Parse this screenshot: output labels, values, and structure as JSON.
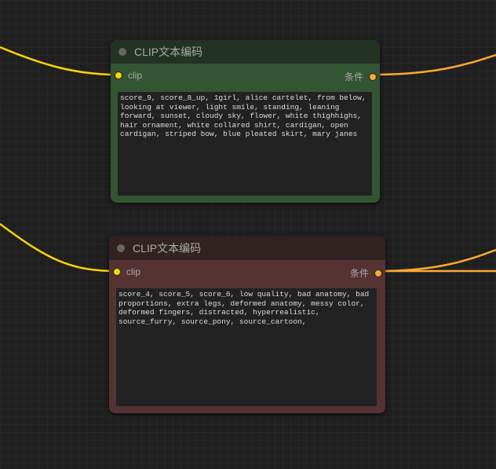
{
  "nodes": [
    {
      "title": "CLIP文本编码",
      "input": "clip",
      "output": "条件",
      "text": "score_9, score_8_up, 1girl, alice cartelet, from below, looking at viewer, light smile, standing, leaning forward, sunset, cloudy sky, flower, white thighhighs, hair ornament, white collared shirt, cardigan, open cardigan, striped bow, blue pleated skirt, mary janes"
    },
    {
      "title": "CLIP文本编码",
      "input": "clip",
      "output": "条件",
      "text": "score_4, score_5, score_6, low quality, bad anatomy, bad proportions, extra legs, deformed anatomy, messy color, deformed fingers, distracted, hyperrealistic, source_furry, source_pony, source_cartoon,"
    }
  ],
  "colors": {
    "clip_wire": "#ffd500",
    "cond_wire": "#ffa931"
  }
}
